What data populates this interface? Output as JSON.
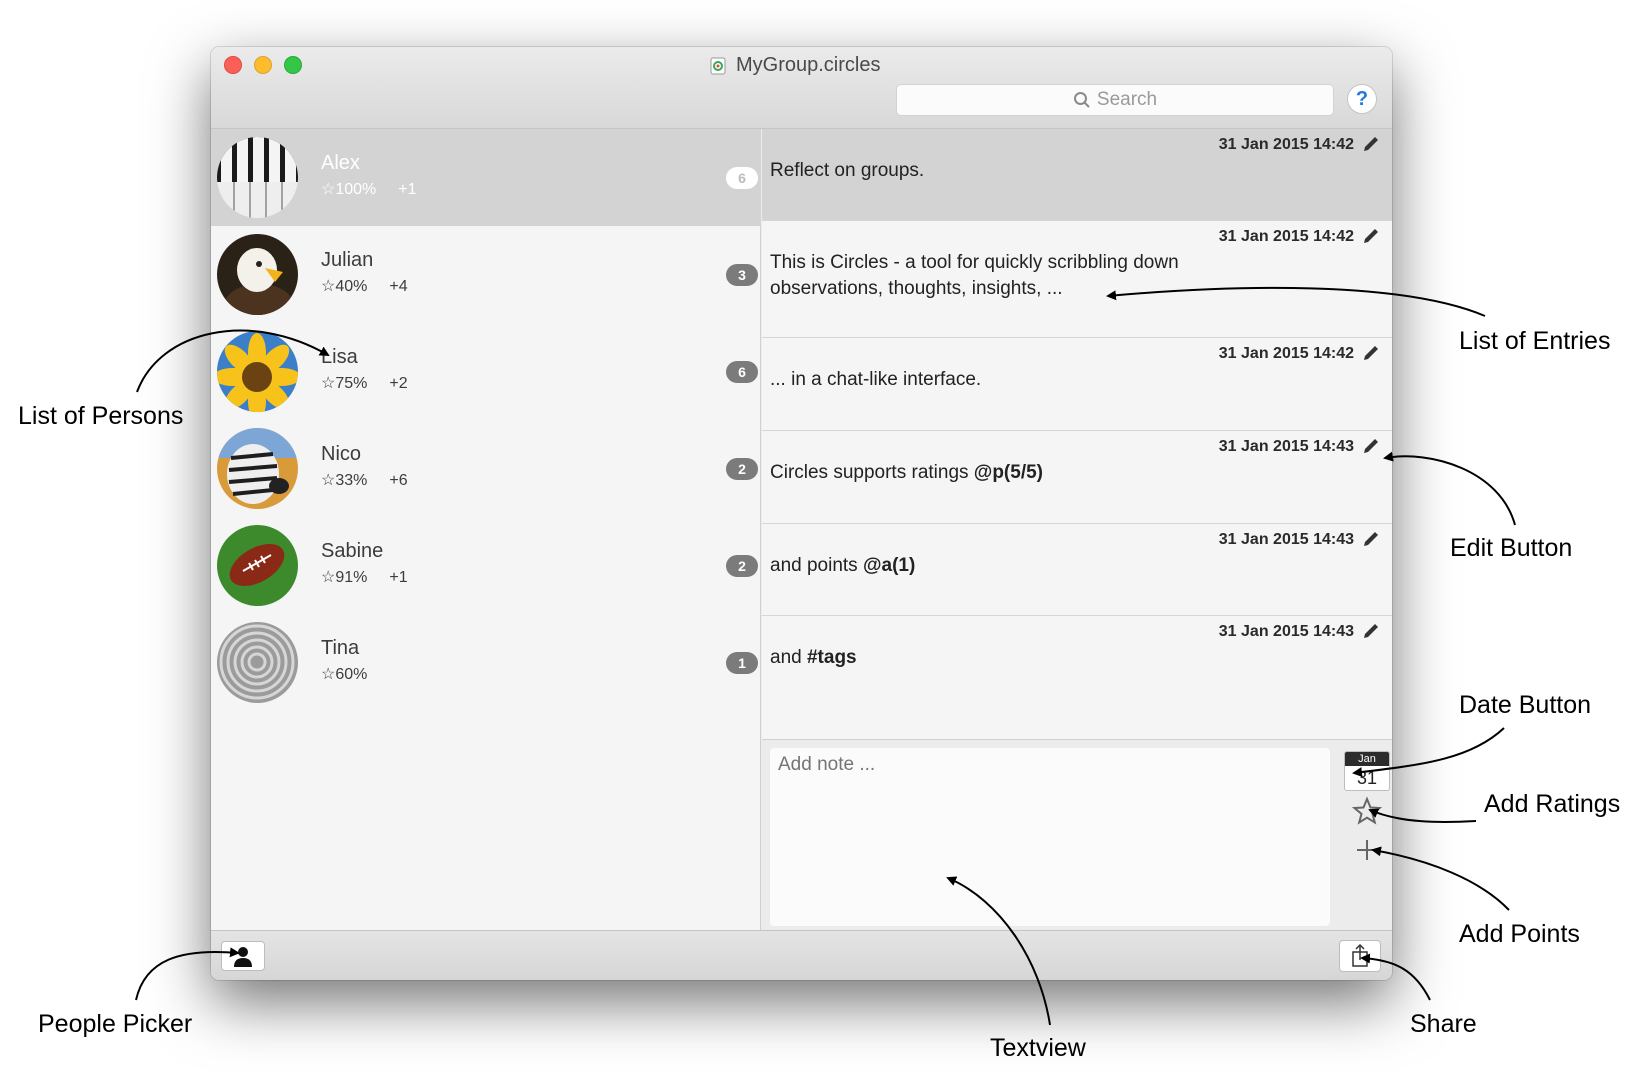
{
  "window": {
    "title": "MyGroup.circles"
  },
  "search": {
    "placeholder": "Search"
  },
  "help_label": "?",
  "persons": [
    {
      "name": "Alex",
      "rating": "☆100%",
      "points": "+1",
      "count": "6",
      "selected": true,
      "avatar": "piano-keys"
    },
    {
      "name": "Julian",
      "rating": "☆40%",
      "points": "+4",
      "count": "3",
      "selected": false,
      "avatar": "eagle"
    },
    {
      "name": "Lisa",
      "rating": "☆75%",
      "points": "+2",
      "count": "6",
      "selected": false,
      "avatar": "sunflower"
    },
    {
      "name": "Nico",
      "rating": "☆33%",
      "points": "+6",
      "count": "2",
      "selected": false,
      "avatar": "zebra"
    },
    {
      "name": "Sabine",
      "rating": "☆91%",
      "points": "+1",
      "count": "2",
      "selected": false,
      "avatar": "football"
    },
    {
      "name": "Tina",
      "rating": "☆60%",
      "points": "",
      "count": "1",
      "selected": false,
      "avatar": "zen-sand"
    }
  ],
  "entries": [
    {
      "date": "31 Jan 2015 14:42",
      "text": "Reflect on groups.",
      "bold": "",
      "selected": true
    },
    {
      "date": "31 Jan 2015 14:42",
      "text": "This is Circles - a tool for quickly scribbling down observations, thoughts, insights, ...",
      "bold": "",
      "selected": false
    },
    {
      "date": "31 Jan 2015 14:42",
      "text": "... in a chat-like interface.",
      "bold": "",
      "selected": false
    },
    {
      "date": "31 Jan 2015 14:43",
      "text": "Circles supports ratings ",
      "bold": "@p(5/5)",
      "selected": false
    },
    {
      "date": "31 Jan 2015 14:43",
      "text": "and points ",
      "bold": "@a(1)",
      "selected": false
    },
    {
      "date": "31 Jan 2015 14:43",
      "text": "and ",
      "bold": "#tags",
      "selected": false
    }
  ],
  "compose": {
    "placeholder": "Add note ...",
    "date_month": "Jan",
    "date_day": "31"
  },
  "annotations": {
    "list_of_persons": "List of Persons",
    "list_of_entries": "List of Entries",
    "edit_button": "Edit Button",
    "date_button": "Date Button",
    "add_ratings": "Add Ratings",
    "add_points": "Add Points",
    "people_picker": "People Picker",
    "textview": "Textview",
    "share": "Share"
  }
}
